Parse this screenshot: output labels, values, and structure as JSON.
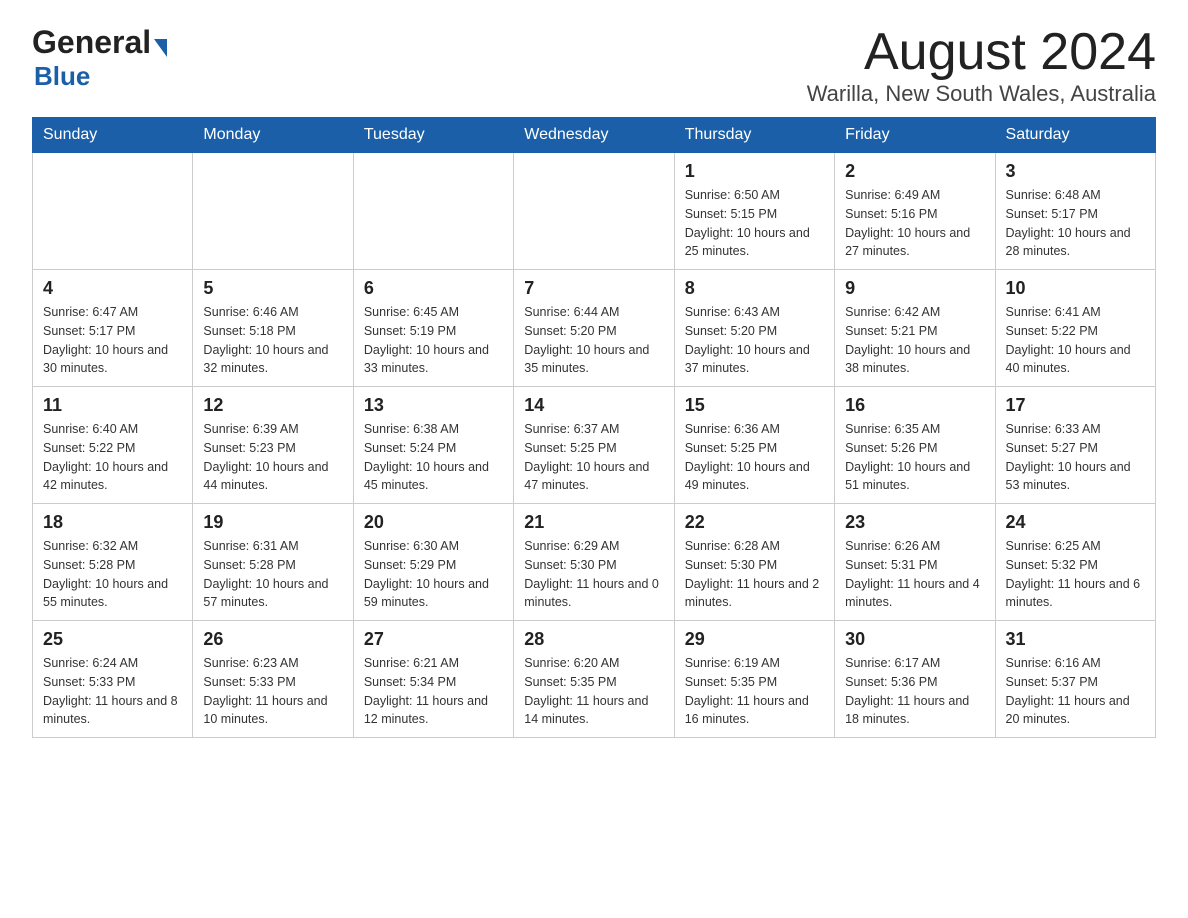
{
  "header": {
    "logo_general": "General",
    "logo_blue": "Blue",
    "month_title": "August 2024",
    "location": "Warilla, New South Wales, Australia"
  },
  "calendar": {
    "days_of_week": [
      "Sunday",
      "Monday",
      "Tuesday",
      "Wednesday",
      "Thursday",
      "Friday",
      "Saturday"
    ],
    "weeks": [
      [
        {
          "day": "",
          "info": ""
        },
        {
          "day": "",
          "info": ""
        },
        {
          "day": "",
          "info": ""
        },
        {
          "day": "",
          "info": ""
        },
        {
          "day": "1",
          "info": "Sunrise: 6:50 AM\nSunset: 5:15 PM\nDaylight: 10 hours and 25 minutes."
        },
        {
          "day": "2",
          "info": "Sunrise: 6:49 AM\nSunset: 5:16 PM\nDaylight: 10 hours and 27 minutes."
        },
        {
          "day": "3",
          "info": "Sunrise: 6:48 AM\nSunset: 5:17 PM\nDaylight: 10 hours and 28 minutes."
        }
      ],
      [
        {
          "day": "4",
          "info": "Sunrise: 6:47 AM\nSunset: 5:17 PM\nDaylight: 10 hours and 30 minutes."
        },
        {
          "day": "5",
          "info": "Sunrise: 6:46 AM\nSunset: 5:18 PM\nDaylight: 10 hours and 32 minutes."
        },
        {
          "day": "6",
          "info": "Sunrise: 6:45 AM\nSunset: 5:19 PM\nDaylight: 10 hours and 33 minutes."
        },
        {
          "day": "7",
          "info": "Sunrise: 6:44 AM\nSunset: 5:20 PM\nDaylight: 10 hours and 35 minutes."
        },
        {
          "day": "8",
          "info": "Sunrise: 6:43 AM\nSunset: 5:20 PM\nDaylight: 10 hours and 37 minutes."
        },
        {
          "day": "9",
          "info": "Sunrise: 6:42 AM\nSunset: 5:21 PM\nDaylight: 10 hours and 38 minutes."
        },
        {
          "day": "10",
          "info": "Sunrise: 6:41 AM\nSunset: 5:22 PM\nDaylight: 10 hours and 40 minutes."
        }
      ],
      [
        {
          "day": "11",
          "info": "Sunrise: 6:40 AM\nSunset: 5:22 PM\nDaylight: 10 hours and 42 minutes."
        },
        {
          "day": "12",
          "info": "Sunrise: 6:39 AM\nSunset: 5:23 PM\nDaylight: 10 hours and 44 minutes."
        },
        {
          "day": "13",
          "info": "Sunrise: 6:38 AM\nSunset: 5:24 PM\nDaylight: 10 hours and 45 minutes."
        },
        {
          "day": "14",
          "info": "Sunrise: 6:37 AM\nSunset: 5:25 PM\nDaylight: 10 hours and 47 minutes."
        },
        {
          "day": "15",
          "info": "Sunrise: 6:36 AM\nSunset: 5:25 PM\nDaylight: 10 hours and 49 minutes."
        },
        {
          "day": "16",
          "info": "Sunrise: 6:35 AM\nSunset: 5:26 PM\nDaylight: 10 hours and 51 minutes."
        },
        {
          "day": "17",
          "info": "Sunrise: 6:33 AM\nSunset: 5:27 PM\nDaylight: 10 hours and 53 minutes."
        }
      ],
      [
        {
          "day": "18",
          "info": "Sunrise: 6:32 AM\nSunset: 5:28 PM\nDaylight: 10 hours and 55 minutes."
        },
        {
          "day": "19",
          "info": "Sunrise: 6:31 AM\nSunset: 5:28 PM\nDaylight: 10 hours and 57 minutes."
        },
        {
          "day": "20",
          "info": "Sunrise: 6:30 AM\nSunset: 5:29 PM\nDaylight: 10 hours and 59 minutes."
        },
        {
          "day": "21",
          "info": "Sunrise: 6:29 AM\nSunset: 5:30 PM\nDaylight: 11 hours and 0 minutes."
        },
        {
          "day": "22",
          "info": "Sunrise: 6:28 AM\nSunset: 5:30 PM\nDaylight: 11 hours and 2 minutes."
        },
        {
          "day": "23",
          "info": "Sunrise: 6:26 AM\nSunset: 5:31 PM\nDaylight: 11 hours and 4 minutes."
        },
        {
          "day": "24",
          "info": "Sunrise: 6:25 AM\nSunset: 5:32 PM\nDaylight: 11 hours and 6 minutes."
        }
      ],
      [
        {
          "day": "25",
          "info": "Sunrise: 6:24 AM\nSunset: 5:33 PM\nDaylight: 11 hours and 8 minutes."
        },
        {
          "day": "26",
          "info": "Sunrise: 6:23 AM\nSunset: 5:33 PM\nDaylight: 11 hours and 10 minutes."
        },
        {
          "day": "27",
          "info": "Sunrise: 6:21 AM\nSunset: 5:34 PM\nDaylight: 11 hours and 12 minutes."
        },
        {
          "day": "28",
          "info": "Sunrise: 6:20 AM\nSunset: 5:35 PM\nDaylight: 11 hours and 14 minutes."
        },
        {
          "day": "29",
          "info": "Sunrise: 6:19 AM\nSunset: 5:35 PM\nDaylight: 11 hours and 16 minutes."
        },
        {
          "day": "30",
          "info": "Sunrise: 6:17 AM\nSunset: 5:36 PM\nDaylight: 11 hours and 18 minutes."
        },
        {
          "day": "31",
          "info": "Sunrise: 6:16 AM\nSunset: 5:37 PM\nDaylight: 11 hours and 20 minutes."
        }
      ]
    ]
  }
}
